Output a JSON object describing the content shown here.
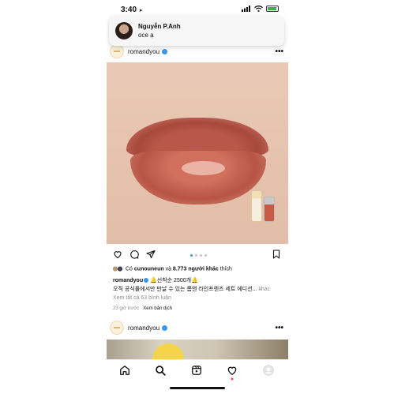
{
  "status_bar": {
    "time": "3:40",
    "location_glyph": "➤"
  },
  "notification": {
    "sender": "Nguyễn P.Anh",
    "message": "oce ạ"
  },
  "post": {
    "username": "romandyou",
    "more_glyph": "•••",
    "likes": {
      "prefix": "Có ",
      "user": "cunouneun",
      "middle": " và ",
      "count": "8.773 người khác",
      "suffix": " thích"
    },
    "caption_user": "romandyou",
    "caption_line1": " 🔔선착순 2500개🔔",
    "caption_line2": "오직 공식몰에서만 만날 수 있는 롬앤 라인프렌즈 세트 에디션...",
    "caption_more": " khác",
    "view_comments": "Xem tất cả 63 bình luận",
    "timestamp": "23 giờ trước",
    "translate": "Xem bản dịch",
    "carousel_dots": 4,
    "carousel_active_index": 0
  },
  "post2": {
    "username": "romandyou",
    "more_glyph": "•••"
  },
  "icons": {
    "like": "heart-icon",
    "comment": "comment-icon",
    "share": "share-icon",
    "save": "bookmark-icon",
    "home": "home-icon",
    "search": "search-icon",
    "reels": "reels-icon",
    "activity": "heart-icon",
    "profile": "profile-icon"
  },
  "colors": {
    "verified": "#3897f0",
    "muted": "#8e8e8e",
    "battery": "#3bb54a"
  }
}
